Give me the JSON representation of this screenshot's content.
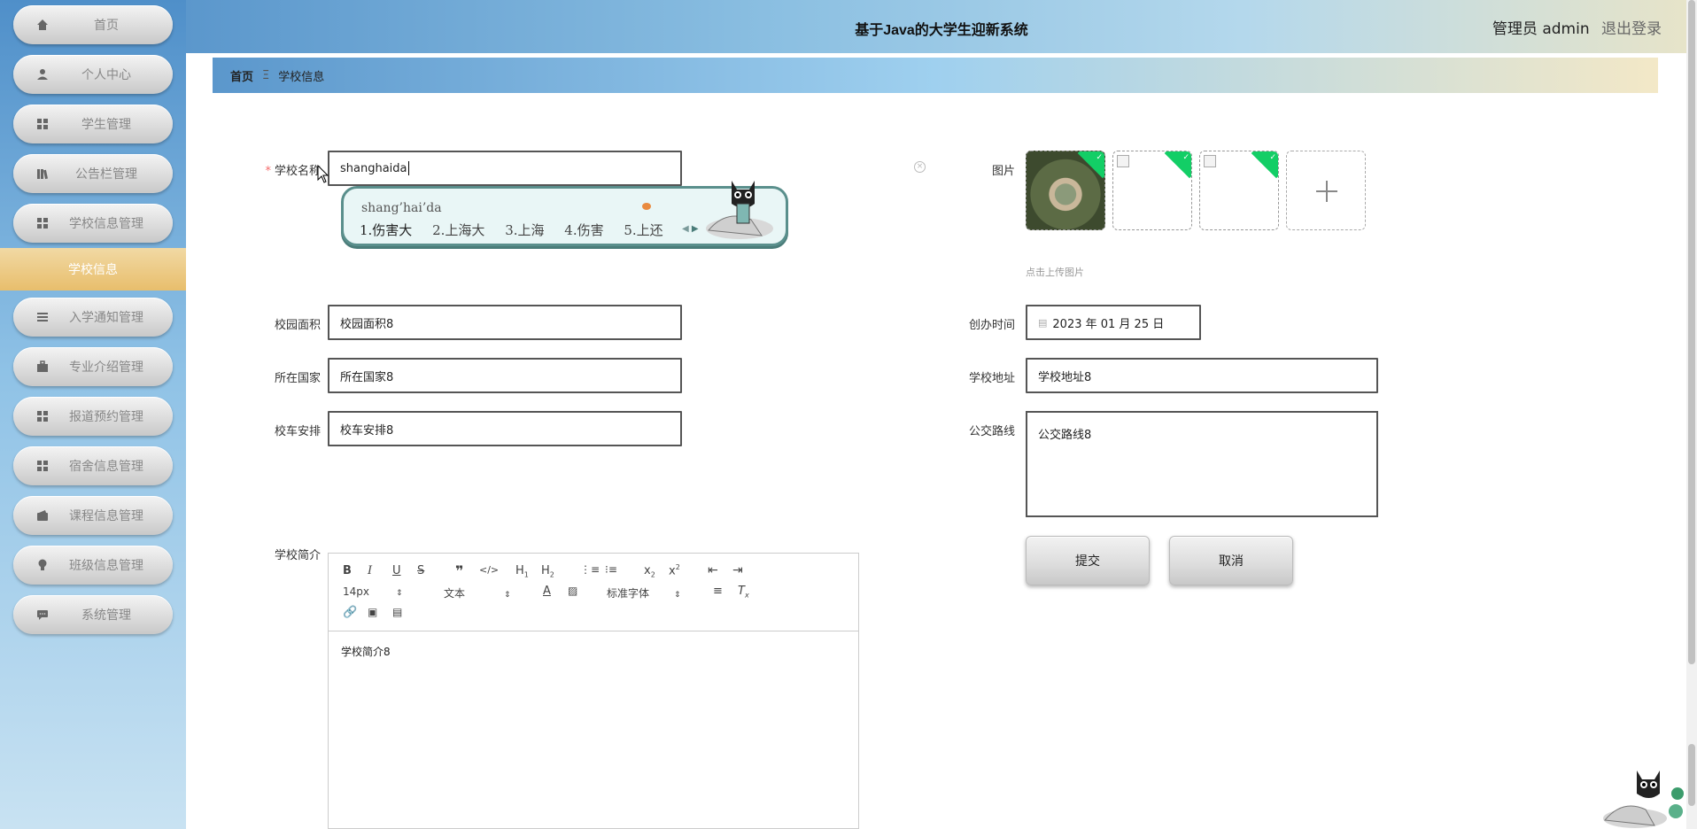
{
  "app": {
    "title": "基于Java的大学生迎新系统"
  },
  "user": {
    "greeting": "管理员 admin",
    "logout": "退出登录"
  },
  "sidebar": {
    "items": [
      {
        "label": "首页",
        "icon": "home-icon"
      },
      {
        "label": "个人中心",
        "icon": "user-icon"
      },
      {
        "label": "学生管理",
        "icon": "grid-icon"
      },
      {
        "label": "公告栏管理",
        "icon": "book-icon"
      },
      {
        "label": "学校信息管理",
        "icon": "grid-icon"
      }
    ],
    "active_sub": "学校信息",
    "items2": [
      {
        "label": "入学通知管理",
        "icon": "list-icon"
      },
      {
        "label": "专业介绍管理",
        "icon": "briefcase-icon"
      },
      {
        "label": "报道预约管理",
        "icon": "grid-icon"
      },
      {
        "label": "宿舍信息管理",
        "icon": "grid-icon"
      },
      {
        "label": "课程信息管理",
        "icon": "wallet-icon"
      },
      {
        "label": "班级信息管理",
        "icon": "bulb-icon"
      },
      {
        "label": "系统管理",
        "icon": "chat-icon"
      }
    ]
  },
  "breadcrumb": {
    "home": "首页",
    "sep": "Ξ",
    "current": "学校信息"
  },
  "form": {
    "school_name": {
      "label": "学校名称",
      "value": "shanghaida"
    },
    "campus_area": {
      "label": "校园面积",
      "value": "校园面积8"
    },
    "country": {
      "label": "所在国家",
      "value": "所在国家8"
    },
    "bus": {
      "label": "校车安排",
      "value": "校车安排8"
    },
    "picture": {
      "label": "图片",
      "tip": "点击上传图片"
    },
    "founded": {
      "label": "创办时间",
      "value": "2023 年 01 月 25 日"
    },
    "address": {
      "label": "学校地址",
      "value": "学校地址8"
    },
    "transit": {
      "label": "公交路线",
      "value": "公交路线8"
    },
    "intro": {
      "label": "学校简介",
      "value": "学校简介8"
    },
    "submit": "提交",
    "cancel": "取消"
  },
  "ime": {
    "pinyin": "shang’hai’da",
    "candidates": [
      "1.伤害大",
      "2.上海大",
      "3.上海",
      "4.伤害",
      "5.上还"
    ]
  },
  "editor_toolbar": {
    "font_size": "14px",
    "block": "文本",
    "font_family": "标准字体"
  },
  "colors": {
    "required": "#f56c6c",
    "corner": "#13ce66",
    "active_sub": "#e8be6c"
  }
}
